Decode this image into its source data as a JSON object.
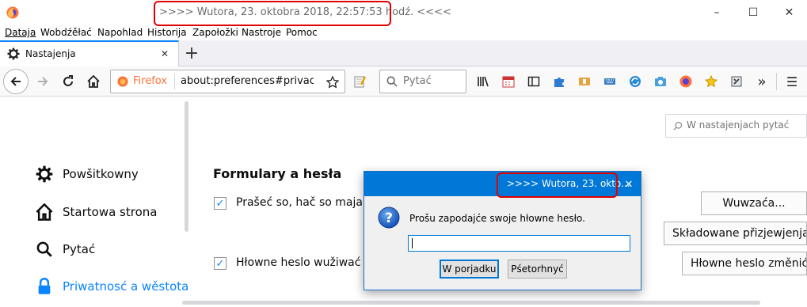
{
  "window": {
    "title": ">>>> Wutora, 23. oktobra 2018, 22:57:53 hodź. <<<<",
    "minimize_glyph": "–",
    "maximize_glyph": "☐",
    "close_glyph": "✕"
  },
  "menu": [
    "Dataja",
    "Wobdźěłać",
    "Napohlad",
    "Historija",
    "Zapołožki",
    "Nastroje",
    "Pomoc"
  ],
  "tab": {
    "label": "Nastajenja",
    "close": "✕",
    "new_tab": "+"
  },
  "nav": {
    "identity": "Firefox",
    "url": "about:preferences#privac",
    "search_placeholder": "Pytać",
    "overflow": "»",
    "menu_glyph": "☰"
  },
  "prefs_search": {
    "placeholder": "W nastajenjach pytać"
  },
  "sidebar": [
    {
      "label": "Powšitkowny",
      "icon": "gear-icon"
    },
    {
      "label": "Startowa strona",
      "icon": "home-icon"
    },
    {
      "label": "Pytać",
      "icon": "search-icon"
    },
    {
      "label": "Priwatnosć a wěstota",
      "icon": "lock-icon"
    }
  ],
  "section": {
    "title": "Formulary a hesła",
    "ask_save": "Prašeć so, hač so maja pi",
    "master_password": "Hłowne heslo wužiwać",
    "exceptions_button": "Wuwzaća...",
    "saved_logins_button": "Składowane přizjewjenja...",
    "change_master_button": "Hłowne heslo změnić..."
  },
  "dialog": {
    "title": ">>>> Wutora, 23. okto...",
    "close": "✕",
    "message": "Prošu zapodajće swoje hłowne hesło.",
    "ok": "W porjadku",
    "cancel": "Pśetorhnyć"
  },
  "colors": {
    "accent": "#0a84ff",
    "dialog_titlebar": "#0078d7",
    "highlight": "#e00000",
    "firefox_orange": "#ff7139"
  }
}
